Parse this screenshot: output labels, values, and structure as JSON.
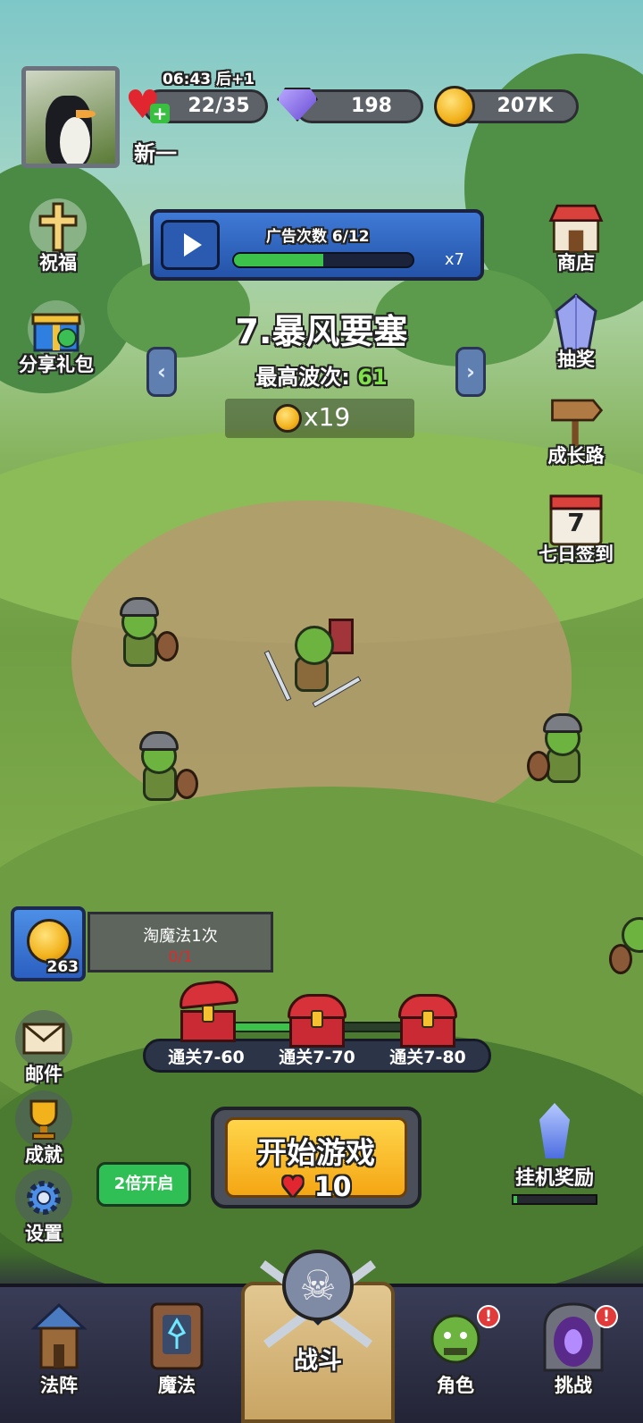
{
  "status": {
    "time": "06:43 后+1"
  },
  "player": {
    "name": "新一"
  },
  "resources": {
    "stamina": "22/35",
    "gems": "198",
    "gold": "207K"
  },
  "left_menu": {
    "blessing": "祝福",
    "share_gift": "分享礼包"
  },
  "right_menu": {
    "shop": "商店",
    "lottery": "抽奖",
    "growth_path": "成长路",
    "seven_day_signin": "七日签到",
    "calendar_day": "7"
  },
  "ad_bar": {
    "title": "广告次数 6/12",
    "progress": 0.5,
    "multiplier": "x7"
  },
  "level": {
    "title": "7.暴风要塞",
    "best_wave_label": "最高波次:",
    "best_wave_value": "61",
    "reward": "x19",
    "prev": "‹",
    "next": "›"
  },
  "tao_magic": {
    "coin_count": "263",
    "label": "淘魔法1次",
    "progress": "0/1"
  },
  "chests": {
    "progress": 0.4,
    "items": [
      {
        "label": "通关7-60"
      },
      {
        "label": "通关7-70"
      },
      {
        "label": "通关7-80"
      }
    ]
  },
  "left_bottom": {
    "mail": "邮件",
    "achievement": "成就",
    "settings": "设置"
  },
  "start_game": {
    "label": "开始游戏",
    "heart": "♥",
    "cost": "10"
  },
  "double_speed": {
    "label": "2倍开启"
  },
  "idle_reward": {
    "label": "挂机奖励",
    "progress": 0.04
  },
  "nav": {
    "formation": "法阵",
    "magic": "魔法",
    "battle": "战斗",
    "character": "角色",
    "challenge": "挑战",
    "alert": "!"
  },
  "colors": {
    "health_red": "#e2262f",
    "progress_green": "#3cc24a",
    "start_yellow": "#ffd54a",
    "nav_bg": "#2e2f46"
  }
}
